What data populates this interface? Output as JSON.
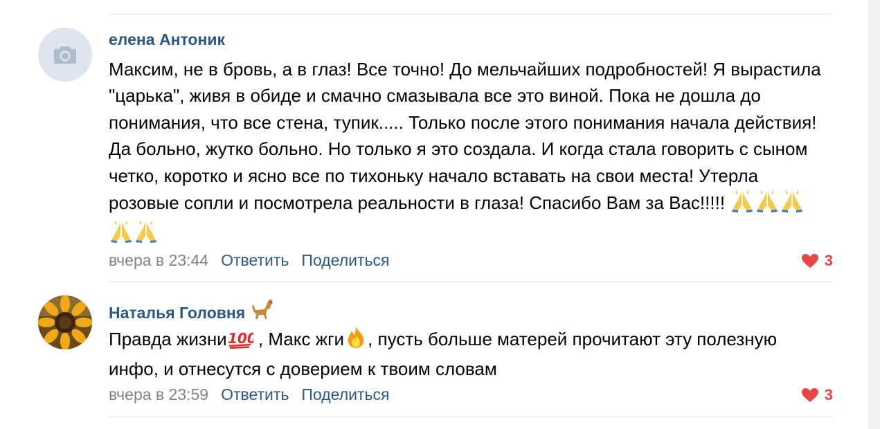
{
  "colors": {
    "author": "#2a5885",
    "date": "#828282",
    "like": "#e64646",
    "divider": "#e3e6ea"
  },
  "comments": [
    {
      "author": "елена Антоник",
      "avatar": "camera-placeholder-icon",
      "text_parts": [
        "Максим, не в бровь, а в глаз! Все точно! До мельчайших подробностей! Я вырастила \"царька\", живя в обиде и смачно смазывала все это виной. Пока не дошла до понимания, что все стена, тупик..... Только после этого понимания начала действия! Да больно, жутко больно. Но только я это создала. И когда стала говорить с сыном четко, коротко и ясно все по тихоньку начало вставать на свои места! Утерла розовые сопли и посмотрела реальности в глаза! Спасибо Вам за Вас!!!!! "
      ],
      "trailing_emoji": [
        "folded-hands-icon",
        "folded-hands-icon",
        "folded-hands-icon",
        "folded-hands-icon",
        "folded-hands-icon"
      ],
      "date": "вчера в 23:44",
      "reply": "Ответить",
      "share": "Поделиться",
      "likes": "3"
    },
    {
      "author": "Наталья Головня",
      "author_emoji": "dog-icon",
      "avatar": "sunflower-avatar",
      "text_part1": "Правда жизни",
      "emoji1": "hundred-points-icon",
      "text_part2": " , Макс жги",
      "emoji2": "fire-icon",
      "text_part3": ", пусть больше матерей прочитают эту полезную инфо, и отнесутся с доверием к твоим словам",
      "date": "вчера в 23:59",
      "reply": "Ответить",
      "share": "Поделиться",
      "likes": "3"
    }
  ]
}
